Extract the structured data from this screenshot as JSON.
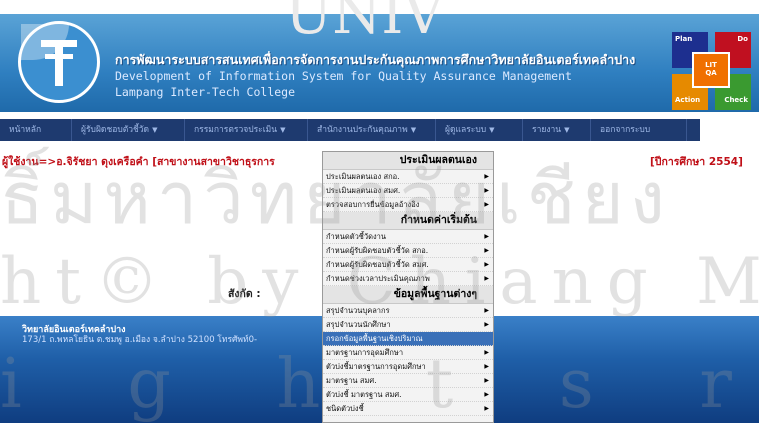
{
  "header": {
    "title_th": "การพัฒนาระบบสารสนเทศเพื่อการจัดการงานประกันคุณภาพการศึกษาวิทยาลัยอินเตอร์เทคลำปาง",
    "title_en": "Development of Information System for Quality Assurance Management",
    "college_en": "Lampang Inter-Tech College",
    "pdca": {
      "plan": "Plan",
      "do": "Do",
      "action": "Action",
      "check": "Check",
      "center_top": "LIT",
      "center_bottom": "QA"
    }
  },
  "nav": {
    "items": [
      {
        "label": "หน้าหลัก",
        "arrow": ""
      },
      {
        "label": "ผู้รับผิดชอบตัวชี้วัด",
        "arrow": "▼"
      },
      {
        "label": "กรรมการตรวจประเมิน",
        "arrow": "▼"
      },
      {
        "label": "สำนักงานประกันคุณภาพ",
        "arrow": "▼"
      },
      {
        "label": "ผู้ดูแลระบบ",
        "arrow": "▼"
      },
      {
        "label": "รายงาน",
        "arrow": "▼"
      },
      {
        "label": "ออกจากระบบ",
        "arrow": ""
      }
    ]
  },
  "userbar": {
    "user": "ผู้ใช้งาน=>อ.จิรัชยา  ดุงเครือคำ  [สาขางานสาขาวิชาธุรการ",
    "year": "[ปีการศึกษา  2554]"
  },
  "affiliation_label": "สังกัด :",
  "footer": {
    "college": "วิทยาลัยอินเตอร์เทคลำปาง",
    "address": "173/1 ถ.พหลโยธิน ต.ชมพู อ.เมือง จ.ลำปาง 52100 โทรศัพท์0-"
  },
  "dropdown": {
    "sections": [
      {
        "heading": "ประเมินผลตนเอง",
        "items": [
          {
            "label": "ประเมินผลตนเอง  สกอ.",
            "highlighted": false
          },
          {
            "label": "ประเมินผลตนเอง  สมศ.",
            "highlighted": false
          },
          {
            "label": "ตรวจสอบการยื่นข้อมูลอ้างอิง",
            "highlighted": false
          }
        ]
      },
      {
        "heading": "กำหนดค่าเริ่มต้น",
        "items": [
          {
            "label": "กำหนดตัวชี้วัดงาน",
            "highlighted": false
          },
          {
            "label": "กำหนดผู้รับผิดชอบตัวชี้วัด  สกอ.",
            "highlighted": false
          },
          {
            "label": "กำหนดผู้รับผิดชอบตัวชี้วัด  สมศ.",
            "highlighted": false
          },
          {
            "label": "กำหนดช่วงเวลาประเมินคุณภาพ",
            "highlighted": false
          }
        ]
      },
      {
        "heading": "ข้อมูลพื้นฐานต่างๆ",
        "items": [
          {
            "label": "สรุปจำนวนบุคลากร",
            "highlighted": false
          },
          {
            "label": "สรุปจำนวนนักศึกษา",
            "highlighted": false
          },
          {
            "label": "กรอกข้อมูลพื้นฐานเชิงปริมาณ",
            "highlighted": true
          },
          {
            "label": "มาตรฐานการอุดมศึกษา",
            "highlighted": false
          },
          {
            "label": "ตัวบ่งชี้มาตรฐานการอุดมศึกษา",
            "highlighted": false
          },
          {
            "label": "มาตรฐาน  สมศ.",
            "highlighted": false
          },
          {
            "label": "ตัวบ่งชี้  มาตรฐาน  สมศ.",
            "highlighted": false
          },
          {
            "label": "ชนิดตัวบ่งชี้",
            "highlighted": false
          }
        ]
      }
    ]
  },
  "watermark": {
    "line1": "UNIV",
    "line2": "ธิ์มหาวิทยาลัยเชียง",
    "line3": "ht© by Chiang Mai Univ",
    "line4": "i g h t s r e s e r"
  }
}
